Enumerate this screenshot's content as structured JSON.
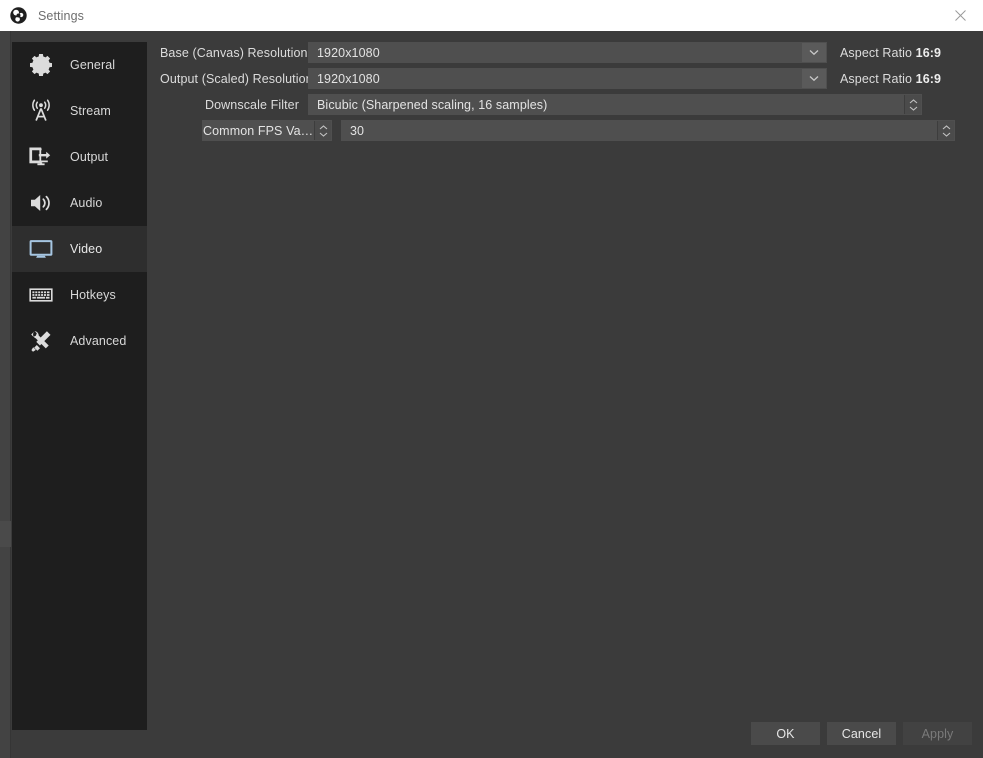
{
  "window": {
    "title": "Settings",
    "logo_icon": "obs-logo-icon",
    "close_icon": "close-icon"
  },
  "sidebar": {
    "items": [
      {
        "id": "general",
        "label": "General",
        "icon": "gear-icon",
        "selected": false
      },
      {
        "id": "stream",
        "label": "Stream",
        "icon": "broadcast-icon",
        "selected": false
      },
      {
        "id": "output",
        "label": "Output",
        "icon": "output-monitor-icon",
        "selected": false
      },
      {
        "id": "audio",
        "label": "Audio",
        "icon": "speaker-icon",
        "selected": false
      },
      {
        "id": "video",
        "label": "Video",
        "icon": "monitor-icon",
        "selected": true
      },
      {
        "id": "hotkeys",
        "label": "Hotkeys",
        "icon": "keyboard-icon",
        "selected": false
      },
      {
        "id": "advanced",
        "label": "Advanced",
        "icon": "tools-icon",
        "selected": false
      }
    ]
  },
  "video_settings": {
    "base_resolution": {
      "label": "Base (Canvas) Resolution",
      "value": "1920x1080",
      "dropdown_icon": "chevron-down-icon",
      "aspect_prefix": "Aspect Ratio",
      "aspect_value": "16:9"
    },
    "output_resolution": {
      "label": "Output (Scaled) Resolution",
      "value": "1920x1080",
      "dropdown_icon": "chevron-down-icon",
      "aspect_prefix": "Aspect Ratio",
      "aspect_value": "16:9"
    },
    "downscale_filter": {
      "label": "Downscale Filter",
      "value": "Bicubic (Sharpened scaling, 16 samples)",
      "spinner_icon": "spinner-arrows-icon"
    },
    "fps": {
      "mode_label": "Common FPS Values",
      "mode_spinner_icon": "spinner-arrows-icon",
      "value": "30",
      "value_spinner_icon": "spinner-arrows-icon"
    }
  },
  "footer": {
    "ok_label": "OK",
    "cancel_label": "Cancel",
    "apply_label": "Apply",
    "apply_disabled": true
  },
  "colors": {
    "titlebar_bg": "#ffffff",
    "dialog_bg": "#3b3b3b",
    "sidebar_bg": "#1e1e1e",
    "selected_bg": "#2e2e2e",
    "accent": "#3f76a8",
    "field_bg": "#4f4f4f",
    "text": "#dcdcdc"
  }
}
